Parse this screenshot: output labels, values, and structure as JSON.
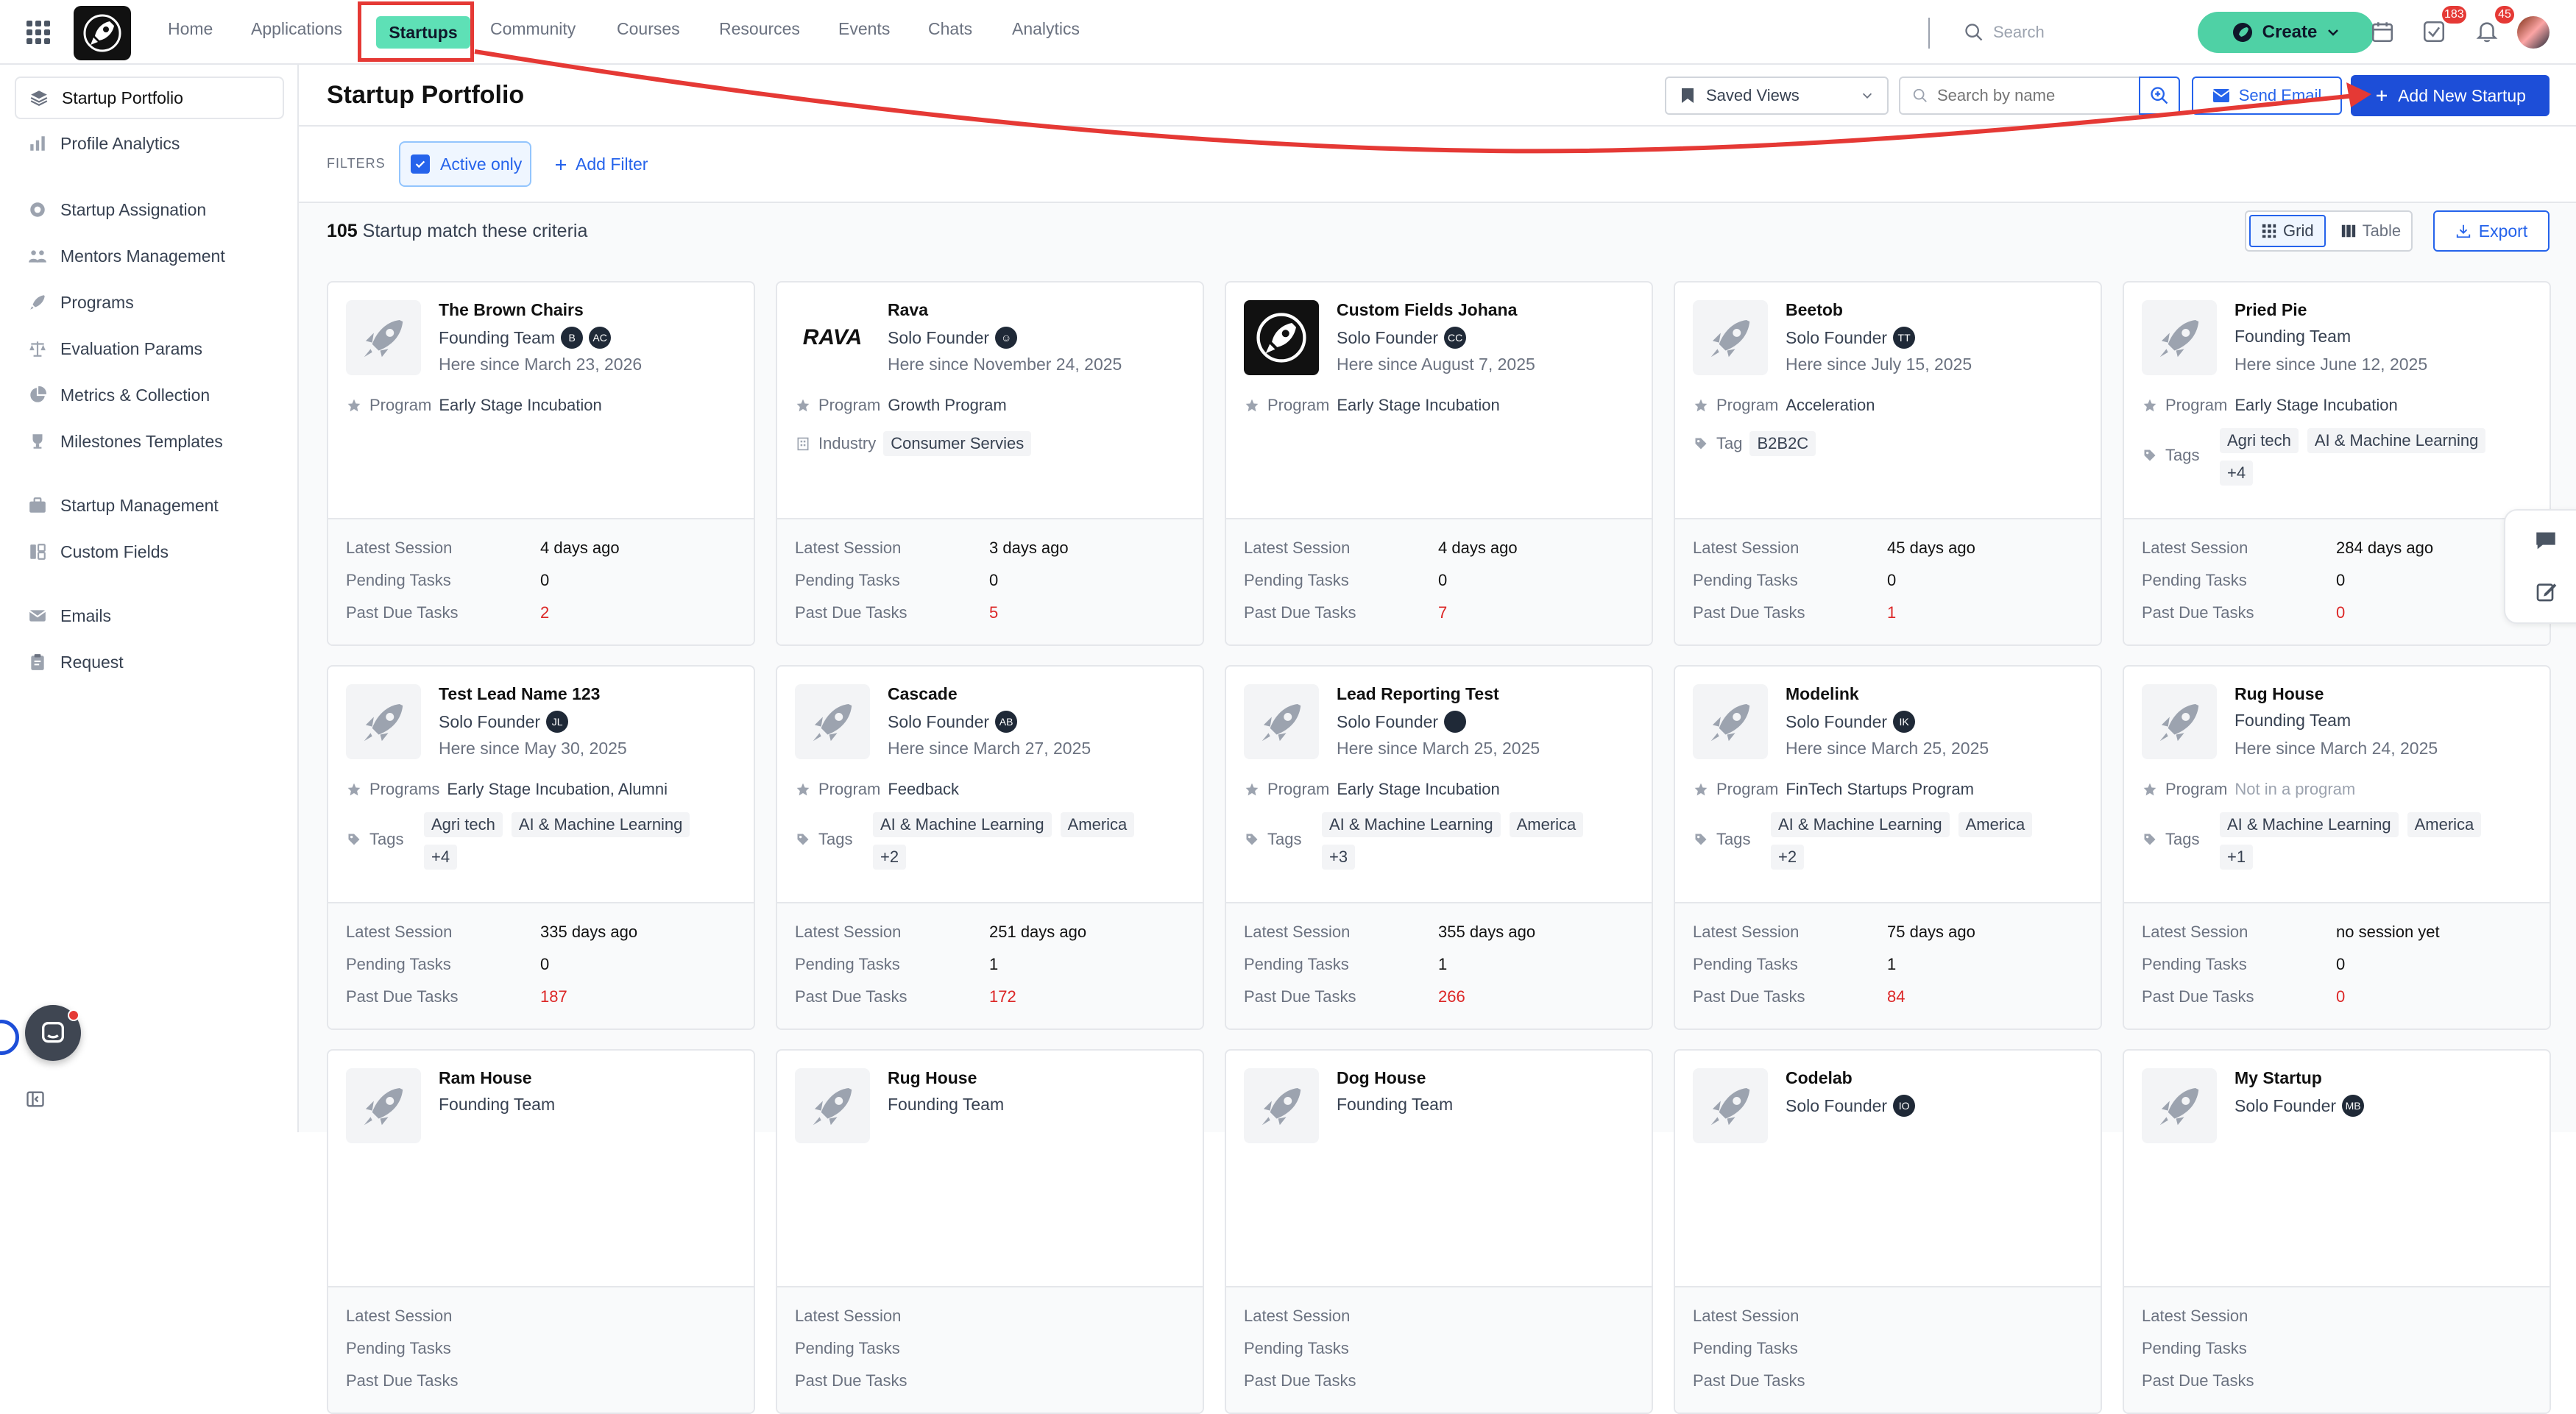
{
  "topnav": {
    "items": [
      "Home",
      "Applications",
      "Startups",
      "Community",
      "Courses",
      "Resources",
      "Events",
      "Chats",
      "Analytics"
    ],
    "search_placeholder": "Search",
    "create_label": "Create",
    "tasks_badge": "183",
    "notifications_badge": "45"
  },
  "sidebar": {
    "items": [
      "Startup Portfolio",
      "Profile Analytics",
      "Startup Assignation",
      "Mentors Management",
      "Programs",
      "Evaluation Params",
      "Metrics & Collection",
      "Milestones Templates",
      "Startup Management",
      "Custom Fields",
      "Emails",
      "Request"
    ]
  },
  "header": {
    "title": "Startup Portfolio",
    "saved_views": "Saved Views",
    "search_placeholder": "Search by name",
    "send_email": "Send Email",
    "add_startup": "Add New Startup"
  },
  "filters": {
    "label": "FILTERS",
    "active_only": "Active only",
    "add_filter": "Add Filter"
  },
  "results": {
    "count": "105",
    "suffix": "Startup match these criteria",
    "grid_label": "Grid",
    "table_label": "Table",
    "export_label": "Export"
  },
  "stat_labels": {
    "session": "Latest Session",
    "pending": "Pending Tasks",
    "past_due": "Past Due Tasks"
  },
  "cards": [
    {
      "name": "The Brown Chairs",
      "team": "Founding Team",
      "avatars": [
        "B",
        "AC"
      ],
      "since": "Here since March 23, 2026",
      "rows": [
        {
          "icon": "star",
          "label": "Program",
          "value": "Early Stage Incubation"
        }
      ],
      "tags": null,
      "session": "4 days ago",
      "pending": "0",
      "past_due": "2"
    },
    {
      "name": "Rava",
      "team": "Solo Founder",
      "avatars": [
        "☺"
      ],
      "since": "Here since November 24, 2025",
      "logo": "RAVA",
      "rows": [
        {
          "icon": "star",
          "label": "Program",
          "value": "Growth Program"
        },
        {
          "icon": "building",
          "label": "Industry",
          "tag": "Consumer Servies"
        }
      ],
      "tags": null,
      "session": "3 days ago",
      "pending": "0",
      "past_due": "5"
    },
    {
      "name": "Custom Fields Johana",
      "team": "Solo Founder",
      "avatars": [
        "CC"
      ],
      "since": "Here since August 7, 2025",
      "logo": "dark",
      "rows": [
        {
          "icon": "star",
          "label": "Program",
          "value": "Early Stage Incubation"
        }
      ],
      "tags": null,
      "session": "4 days ago",
      "pending": "0",
      "past_due": "7"
    },
    {
      "name": "Beetob",
      "team": "Solo Founder",
      "avatars": [
        "TT"
      ],
      "since": "Here since July 15, 2025",
      "rows": [
        {
          "icon": "star",
          "label": "Program",
          "value": "Acceleration"
        },
        {
          "icon": "tag",
          "label": "Tag",
          "tag": "B2B2C"
        }
      ],
      "tags": null,
      "session": "45 days ago",
      "pending": "0",
      "past_due": "1"
    },
    {
      "name": "Pried Pie",
      "team": "Founding Team",
      "avatars": [],
      "since": "Here since June 12, 2025",
      "rows": [
        {
          "icon": "star",
          "label": "Program",
          "value": "Early Stage Incubation"
        }
      ],
      "tags": [
        "Agri tech",
        "AI & Machine Learning",
        "+4"
      ],
      "session": "284 days ago",
      "pending": "0",
      "past_due": "0"
    },
    {
      "name": "Test Lead Name 123",
      "team": "Solo Founder",
      "avatars": [
        "JL"
      ],
      "since": "Here since May 30, 2025",
      "rows": [
        {
          "icon": "star",
          "label": "Programs",
          "value": "Early Stage Incubation, Alumni"
        }
      ],
      "tags": [
        "Agri tech",
        "AI & Machine Learning",
        "+4"
      ],
      "session": "335 days ago",
      "pending": "0",
      "past_due": "187"
    },
    {
      "name": "Cascade",
      "team": "Solo Founder",
      "avatars": [
        "AB"
      ],
      "since": "Here since March 27, 2025",
      "rows": [
        {
          "icon": "star",
          "label": "Program",
          "value": "Feedback"
        }
      ],
      "tags": [
        "AI & Machine Learning",
        "America",
        "+2"
      ],
      "session": "251 days ago",
      "pending": "1",
      "past_due": "172"
    },
    {
      "name": "Lead Reporting Test",
      "team": "Solo Founder",
      "avatars": [
        " "
      ],
      "since": "Here since March 25, 2025",
      "rows": [
        {
          "icon": "star",
          "label": "Program",
          "value": "Early Stage Incubation"
        }
      ],
      "tags": [
        "AI & Machine Learning",
        "America",
        "+3"
      ],
      "session": "355 days ago",
      "pending": "1",
      "past_due": "266"
    },
    {
      "name": "Modelink",
      "team": "Solo Founder",
      "avatars": [
        "IK"
      ],
      "since": "Here since March 25, 2025",
      "rows": [
        {
          "icon": "star",
          "label": "Program",
          "value": "FinTech Startups Program"
        }
      ],
      "tags": [
        "AI & Machine Learning",
        "America",
        "+2"
      ],
      "session": "75 days ago",
      "pending": "1",
      "past_due": "84"
    },
    {
      "name": "Rug House",
      "team": "Founding Team",
      "avatars": [],
      "since": "Here since March 24, 2025",
      "rows": [
        {
          "icon": "star",
          "label": "Program",
          "value": "Not in a program",
          "muted": true
        }
      ],
      "tags": [
        "AI & Machine Learning",
        "America",
        "+1"
      ],
      "session": "no session yet",
      "pending": "0",
      "past_due": "0"
    },
    {
      "name": "Ram House",
      "team": "Founding Team",
      "avatars": [],
      "since": "",
      "rows": [],
      "tags": null,
      "session": "",
      "pending": "",
      "past_due": ""
    },
    {
      "name": "Rug House",
      "team": "Founding Team",
      "avatars": [],
      "since": "",
      "rows": [],
      "tags": null,
      "session": "",
      "pending": "",
      "past_due": ""
    },
    {
      "name": "Dog House",
      "team": "Founding Team",
      "avatars": [],
      "since": "",
      "rows": [],
      "tags": null,
      "session": "",
      "pending": "",
      "past_due": ""
    },
    {
      "name": "Codelab",
      "team": "Solo Founder",
      "avatars": [
        "IO"
      ],
      "since": "",
      "rows": [],
      "tags": null,
      "session": "",
      "pending": "",
      "past_due": ""
    },
    {
      "name": "My Startup",
      "team": "Solo Founder",
      "avatars": [
        "MB"
      ],
      "since": "",
      "rows": [],
      "tags": null,
      "session": "",
      "pending": "",
      "past_due": ""
    }
  ],
  "colors": {
    "accent": "#2563eb",
    "create": "#4fd1a5",
    "danger": "#dc2626",
    "annotation": "#e53935"
  }
}
